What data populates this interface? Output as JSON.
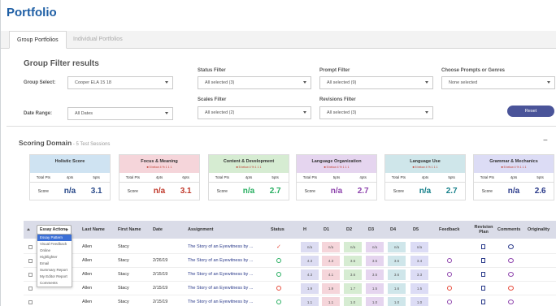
{
  "title": "Portfolio",
  "tabs": [
    {
      "label": "Group Portfolios"
    },
    {
      "label": "Individual Portfolios"
    }
  ],
  "filters": {
    "title": "Group Filter results",
    "group_select": {
      "label": "Group Select:",
      "value": "Cooper ELA 15 18"
    },
    "date_range": {
      "label": "Date Range:",
      "value": "All Dates"
    },
    "status": {
      "label": "Status Filter",
      "value": "All selected (3)"
    },
    "scales": {
      "label": "Scales Filter",
      "value": "All selected (2)"
    },
    "prompt": {
      "label": "Prompt Filter",
      "value": "All selected (9)"
    },
    "revisions": {
      "label": "Revisions Filter",
      "value": "All selected (3)"
    },
    "genres": {
      "label": "Choose Prompts or Genres",
      "value": "None selected"
    },
    "reset_label": "Reset"
  },
  "scoring": {
    "title": "Scoring Domain",
    "subtitle": " - 5 Test Sessions",
    "collapse_label": "−",
    "cards": [
      {
        "title": "Holistic Score",
        "sub": "",
        "color": "#cfe3f2",
        "cols": [
          "Total Pts",
          "4pts",
          "5pts"
        ],
        "row_label": "Score",
        "v1": "n/a",
        "v2": "3.1",
        "v1_color": "#2a4a8a",
        "v2_color": "#2a4a8a"
      },
      {
        "title": "Focus & Meaning",
        "sub": "■ 5 below 4 % 1 1 1",
        "color": "#f5d5da",
        "cols": [
          "Total Pts",
          "4pts",
          "6pts"
        ],
        "row_label": "Score",
        "v1": "n/a",
        "v2": "3.1",
        "v1_color": "#c0392b",
        "v2_color": "#c0392b"
      },
      {
        "title": "Content & Development",
        "sub": "■ 5 below 4 % 1 1 1",
        "color": "#d6ecd2",
        "cols": [
          "Total Pts",
          "4pts",
          "5pts"
        ],
        "row_label": "Score",
        "v1": "n/a",
        "v2": "2.7",
        "v1_color": "#27ae60",
        "v2_color": "#27ae60"
      },
      {
        "title": "Language Organization",
        "sub": "■ 5 below 4 % 1 1 1",
        "color": "#e5d5ef",
        "cols": [
          "Total Pts",
          "5pts",
          "4pts"
        ],
        "row_label": "Score",
        "v1": "n/a",
        "v2": "2.7",
        "v1_color": "#8e44ad",
        "v2_color": "#8e44ad"
      },
      {
        "title": "Language Use",
        "sub": "■ 5 below 4 % 1 1 1",
        "color": "#cfe6ea",
        "cols": [
          "Total Pts",
          "4pts",
          "5pts"
        ],
        "row_label": "Score",
        "v1": "n/a",
        "v2": "2.7",
        "v1_color": "#16808a",
        "v2_color": "#16808a"
      },
      {
        "title": "Grammar & Mechanics",
        "sub": "■ 5 below 4 % 1 1 1",
        "color": "#dcdcf5",
        "cols": [
          "Total Pts",
          "4pts",
          "5pts"
        ],
        "row_label": "Score",
        "v1": "n/a",
        "v2": "2.6",
        "v1_color": "#2a3a8a",
        "v2_color": "#2a3a8a"
      }
    ]
  },
  "grid": {
    "essay_actions_label": "Essay Actions",
    "headers": [
      "Last Name",
      "First Name",
      "Date",
      "Assignment",
      "Status",
      "H",
      "D1",
      "D2",
      "D3",
      "D4",
      "D5",
      "Feedback",
      "Revision Plan",
      "Comments",
      "Originality"
    ],
    "dropdown_items": [
      "Essay Actions",
      "Essay Pattern",
      "Visual Feedback",
      "Online",
      "Highlighter",
      "Email",
      "Summary Report",
      "My Editor Report",
      "Comments"
    ],
    "score_colors": [
      "#dcdcf2",
      "#f5d5da",
      "#d6ecd2",
      "#e5d5ef",
      "#cfe6ea",
      "#dcdcf5"
    ],
    "rows": [
      {
        "last": "Allen",
        "first": "Stacy",
        "date": "",
        "assignment": "The Story of an Eyewitness by ...",
        "status": "check",
        "scores": [
          "n/a",
          "n/a",
          "n/a",
          "n/a",
          "n/a",
          "n/a"
        ],
        "feedback": false,
        "comment_color": "#2a3a8a"
      },
      {
        "last": "Allen",
        "first": "Stacy",
        "date": "2/26/19",
        "assignment": "The Story of an Eyewitness by ...",
        "status": "done",
        "scores": [
          "4.3",
          "4.3",
          "3.6",
          "3.5",
          "3.6",
          "3.4"
        ],
        "feedback": true,
        "comment_color": "#8e44ad"
      },
      {
        "last": "Allen",
        "first": "Stacy",
        "date": "2/15/19",
        "assignment": "The Story of an Eyewitness by ...",
        "status": "done",
        "scores": [
          "4.3",
          "4.1",
          "3.6",
          "3.5",
          "3.6",
          "3.3"
        ],
        "feedback": true,
        "comment_color": "#8e44ad"
      },
      {
        "last": "Allen",
        "first": "Stacy",
        "date": "2/15/19",
        "assignment": "The Story of an Eyewitness by ...",
        "status": "err",
        "scores": [
          "1.9",
          "1.9",
          "1.7",
          "1.5",
          "1.6",
          "1.5"
        ],
        "feedback": true,
        "comment_color": "#e74c3c"
      },
      {
        "last": "Allen",
        "first": "Stacy",
        "date": "2/15/19",
        "assignment": "The Story of an Eyewitness by ...",
        "status": "done",
        "scores": [
          "1.1",
          "1.1",
          "1.0",
          "1.0",
          "1.0",
          "1.0"
        ],
        "feedback": true,
        "comment_color": "#8e44ad"
      }
    ]
  }
}
